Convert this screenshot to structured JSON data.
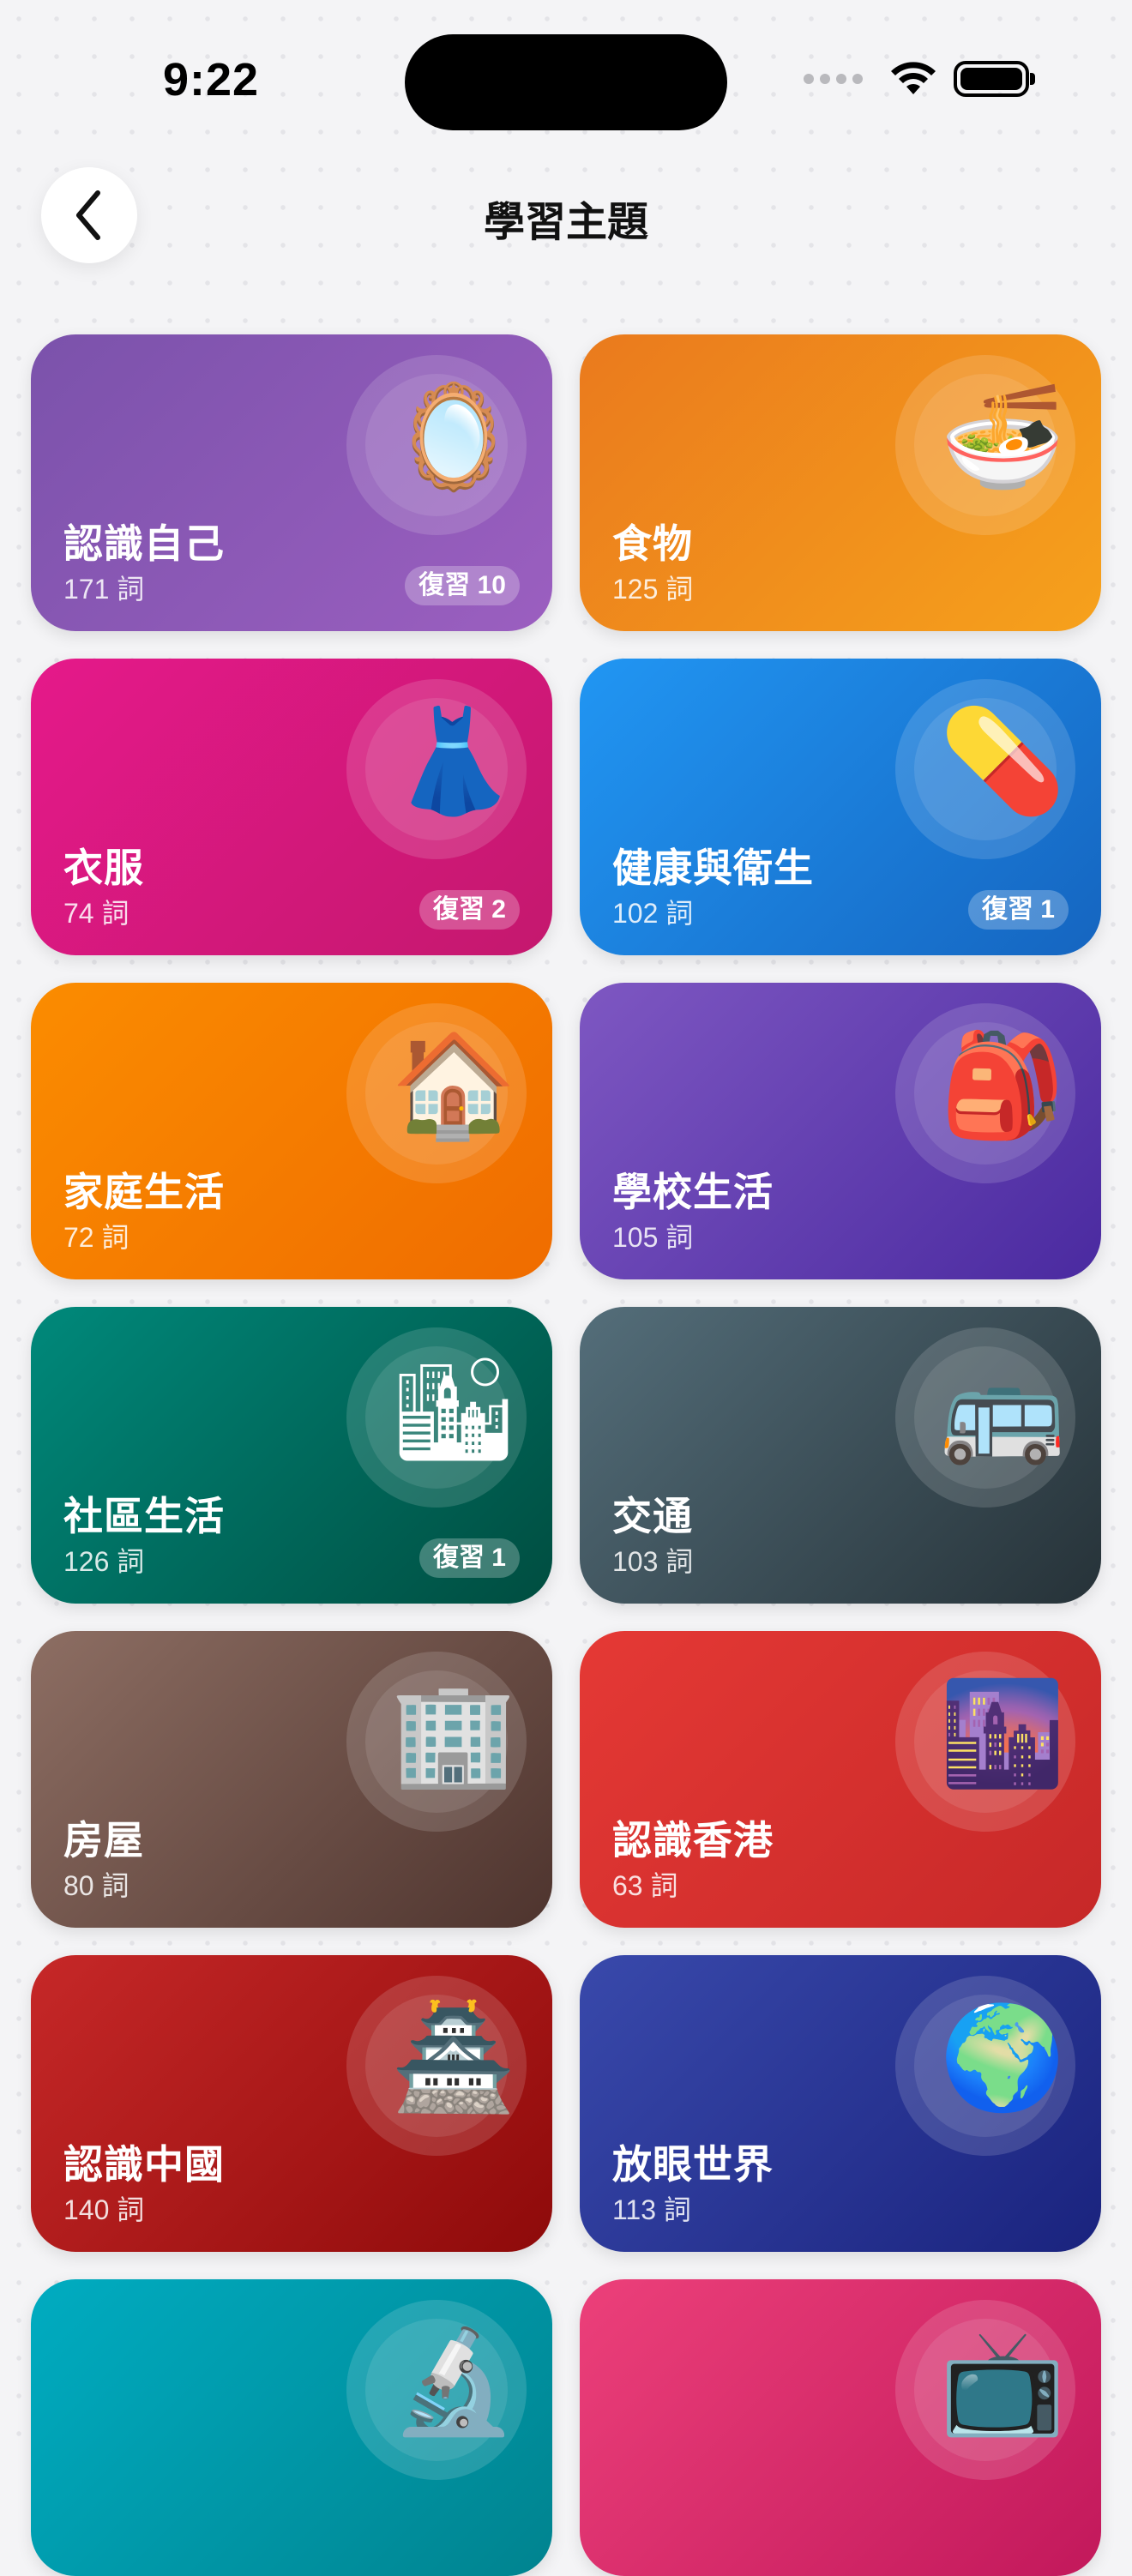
{
  "status_bar": {
    "time": "9:22"
  },
  "nav": {
    "title": "學習主題",
    "back_icon": "chevron-left-icon"
  },
  "topics": [
    {
      "name": "認識自己",
      "count": "171 詞",
      "review": "復習 10",
      "icon": "mirror-icon",
      "emoji": "🪞",
      "colors": [
        "#7b52ab",
        "#9b5fc0"
      ]
    },
    {
      "name": "食物",
      "count": "125 詞",
      "review": "",
      "icon": "noodle-bowl-icon",
      "emoji": "🍜",
      "colors": [
        "#ea7a1d",
        "#f6a11c"
      ]
    },
    {
      "name": "衣服",
      "count": "74 詞",
      "review": "復習 2",
      "icon": "dress-icon",
      "emoji": "👗",
      "colors": [
        "#e5198a",
        "#c4186e"
      ]
    },
    {
      "name": "健康與衛生",
      "count": "102 詞",
      "review": "復習 1",
      "icon": "pill-icon",
      "emoji": "💊",
      "colors": [
        "#2196f3",
        "#1565c0"
      ]
    },
    {
      "name": "家庭生活",
      "count": "72 詞",
      "review": "",
      "icon": "house-icon",
      "emoji": "🏠",
      "colors": [
        "#fb8c00",
        "#ef6c00"
      ]
    },
    {
      "name": "學校生活",
      "count": "105 詞",
      "review": "",
      "icon": "backpack-icon",
      "emoji": "🎒",
      "colors": [
        "#7e57c2",
        "#4a2aa0"
      ]
    },
    {
      "name": "社區生活",
      "count": "126 詞",
      "review": "復習 1",
      "icon": "cityscape-icon",
      "emoji": "🏙",
      "colors": [
        "#00897b",
        "#004d40"
      ]
    },
    {
      "name": "交通",
      "count": "103 詞",
      "review": "",
      "icon": "bus-icon",
      "emoji": "🚌",
      "colors": [
        "#546e7a",
        "#263238"
      ]
    },
    {
      "name": "房屋",
      "count": "80 詞",
      "review": "",
      "icon": "office-building-icon",
      "emoji": "🏢",
      "colors": [
        "#8d6e63",
        "#4e342e"
      ]
    },
    {
      "name": "認識香港",
      "count": "63 詞",
      "review": "",
      "icon": "city-dusk-icon",
      "emoji": "🌆",
      "colors": [
        "#e53935",
        "#c62828"
      ]
    },
    {
      "name": "認識中國",
      "count": "140 詞",
      "review": "",
      "icon": "castle-icon",
      "emoji": "🏯",
      "colors": [
        "#c62828",
        "#8e0a0a"
      ]
    },
    {
      "name": "放眼世界",
      "count": "113 詞",
      "review": "",
      "icon": "globe-icon",
      "emoji": "🌍",
      "colors": [
        "#3949ab",
        "#1a237e"
      ]
    },
    {
      "name": "",
      "count": "",
      "review": "",
      "icon": "microscope-icon",
      "emoji": "🔬",
      "colors": [
        "#00acc1",
        "#00838f"
      ]
    },
    {
      "name": "",
      "count": "",
      "review": "",
      "icon": "television-icon",
      "emoji": "📺",
      "colors": [
        "#ec407a",
        "#c2185b"
      ]
    }
  ]
}
